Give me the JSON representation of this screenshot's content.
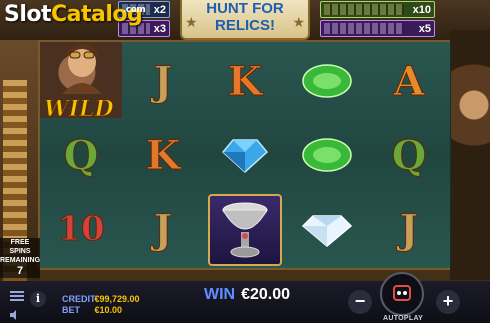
{
  "watermark": {
    "slot": "Slot",
    "catalog": "Catalog",
    "com": ".com"
  },
  "header": {
    "hunt_line1": "HUNT FOR",
    "hunt_line2": "RELICS!",
    "collectors": [
      {
        "multiplier": "x2",
        "color": "blue"
      },
      {
        "multiplier": "x3",
        "color": "purple"
      },
      {
        "multiplier": "x10",
        "color": "green"
      },
      {
        "multiplier": "x5",
        "color": "purple"
      }
    ]
  },
  "side": {
    "free_spins_label_1": "FREE SPINS",
    "free_spins_label_2": "REMAINING",
    "free_spins_count": "7"
  },
  "reels": [
    {
      "top": "WILD",
      "mid": "Q",
      "bot": "10"
    },
    {
      "top": "J",
      "mid": "K",
      "bot": "J"
    },
    {
      "top": "K",
      "mid": "blue-gem",
      "bot": "chalice"
    },
    {
      "top": "green-gem",
      "mid": "green-gem",
      "bot": "diamond"
    },
    {
      "top": "A",
      "mid": "Q",
      "bot": "J"
    }
  ],
  "wild_label": "WILD",
  "footer": {
    "credit_label": "CREDIT",
    "credit_value": "€99,729.00",
    "bet_label": "BET",
    "bet_value": "€10.00",
    "win_label": "WIN",
    "win_value": "€20.00",
    "minus_label": "−",
    "plus_label": "+",
    "autoplay_label": "AUTOPLAY"
  },
  "colors": {
    "accent_gold": "#f7c400",
    "win_blue": "#5f8fff",
    "reel_bg": "#214640"
  }
}
